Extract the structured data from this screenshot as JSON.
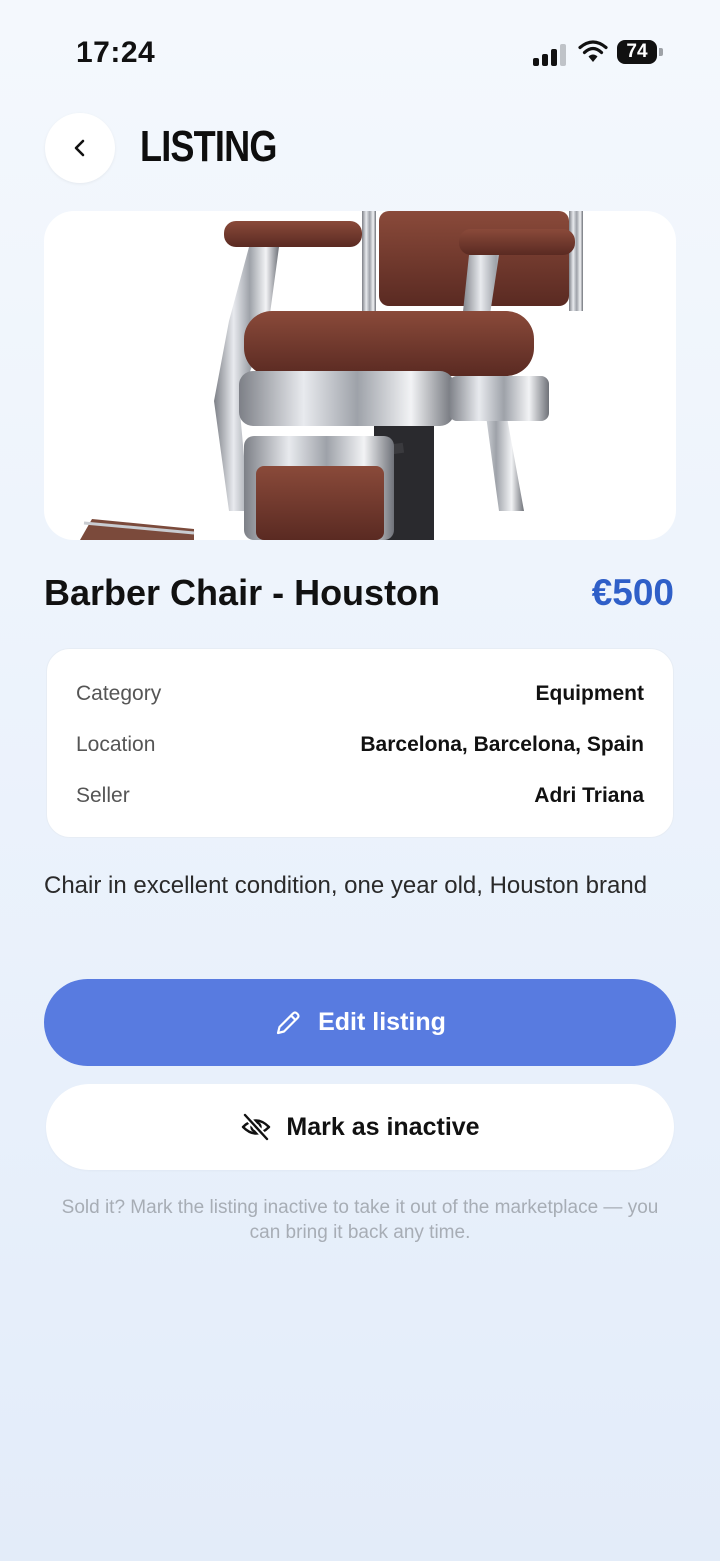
{
  "status_bar": {
    "time": "17:24",
    "battery": "74"
  },
  "header": {
    "title": "LISTING",
    "back_icon": "chevron-left-icon"
  },
  "listing": {
    "photo": "barber-chair-photo",
    "title": "Barber Chair - Houston",
    "price": "€500",
    "details": [
      {
        "label": "Category",
        "value": "Equipment"
      },
      {
        "label": "Location",
        "value": "Barcelona, Barcelona, Spain"
      },
      {
        "label": "Seller",
        "value": "Adri Triana"
      }
    ],
    "description": "Chair in excellent condition, one year old, Houston brand"
  },
  "actions": {
    "edit_label": "Edit listing",
    "edit_icon": "pencil-icon",
    "inactive_label": "Mark as inactive",
    "inactive_icon": "eye-off-icon"
  },
  "hint": "Sold it? Mark the listing inactive to take it out of the marketplace — you can bring it back any time.",
  "colors": {
    "accent": "#587be0",
    "price": "#2f5fc8",
    "background": "#eef4fc"
  }
}
